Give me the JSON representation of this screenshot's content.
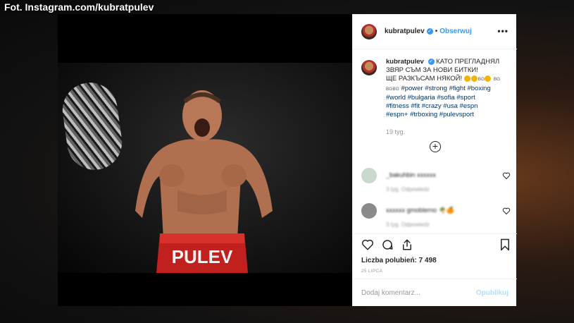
{
  "credit": "Fot. Instagram.com/kubratpulev",
  "post": {
    "username": "kubratpulev",
    "verified_mark": "✓",
    "separator": "•",
    "follow_label": "Obserwuj",
    "more_label": "•••",
    "caption_line1": "КАТО ПРЕГЛАДНЯЛ",
    "caption_line2": "ЗВЯР СЪМ ЗА НОВИ БИТКИ!",
    "caption_line3": "ЩЕ РАЗКЪСАМ НЯКОЙ!",
    "flag_a": "BG",
    "flag_b": "BG",
    "flag_c": "BGBG",
    "hashtags_1a": "#power",
    "hashtags_1b": "#strong",
    "hashtags_1c": "#fight",
    "hashtags_1d": "#boxing",
    "hashtags_2": "#world #bulgaria #sofia #sport",
    "hashtags_3": "#fitness #fit #crazy #usa #espn",
    "hashtags_4": "#espn+ #trboxing #pulevsport",
    "time_ago": "19 tyg.",
    "load_more_label": "+",
    "comments": [
      {
        "text": "_bakuhbin xxxxxx",
        "meta": "3 tyg.    Odpowiedz"
      },
      {
        "text": "xxxxxx gmoblerno 🌴🍊",
        "meta": "3 tyg.    Odpowiedz"
      }
    ],
    "likes": "Liczba polubień: 7 498",
    "date": "25 LIPCA",
    "comment_placeholder": "Dodaj komentarz...",
    "publish_label": "Opublikuj",
    "photo_trunks_text": "PULEV"
  },
  "colors": {
    "link_blue": "#3897f0",
    "hashtag": "#003569",
    "muted": "#999999"
  },
  "icons": [
    "heart-icon",
    "comment-icon",
    "share-icon",
    "bookmark-icon",
    "plus-circle-icon",
    "more-options-icon",
    "verified-badge-icon"
  ]
}
